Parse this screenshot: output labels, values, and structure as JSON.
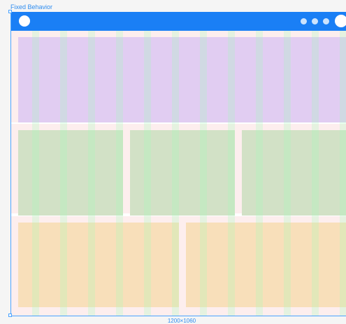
{
  "frame": {
    "title": "Fixed Behavior",
    "size_label": "1200×1060"
  },
  "header": {
    "bar_color": "#1a7ff5",
    "logo_icon": "circle-logo-icon",
    "menu_dots": 3,
    "avatar_icon": "avatar-icon"
  },
  "layout": {
    "sections": [
      {
        "name": "full-width-row",
        "color": "#e1cdf2",
        "columns": 1
      },
      {
        "name": "three-column-row",
        "color": "#d2e1c6",
        "columns": 3
      },
      {
        "name": "two-column-row",
        "color": "#f8dfba",
        "columns": 2
      }
    ],
    "grid_overlay_color": "#a0ffb9"
  }
}
